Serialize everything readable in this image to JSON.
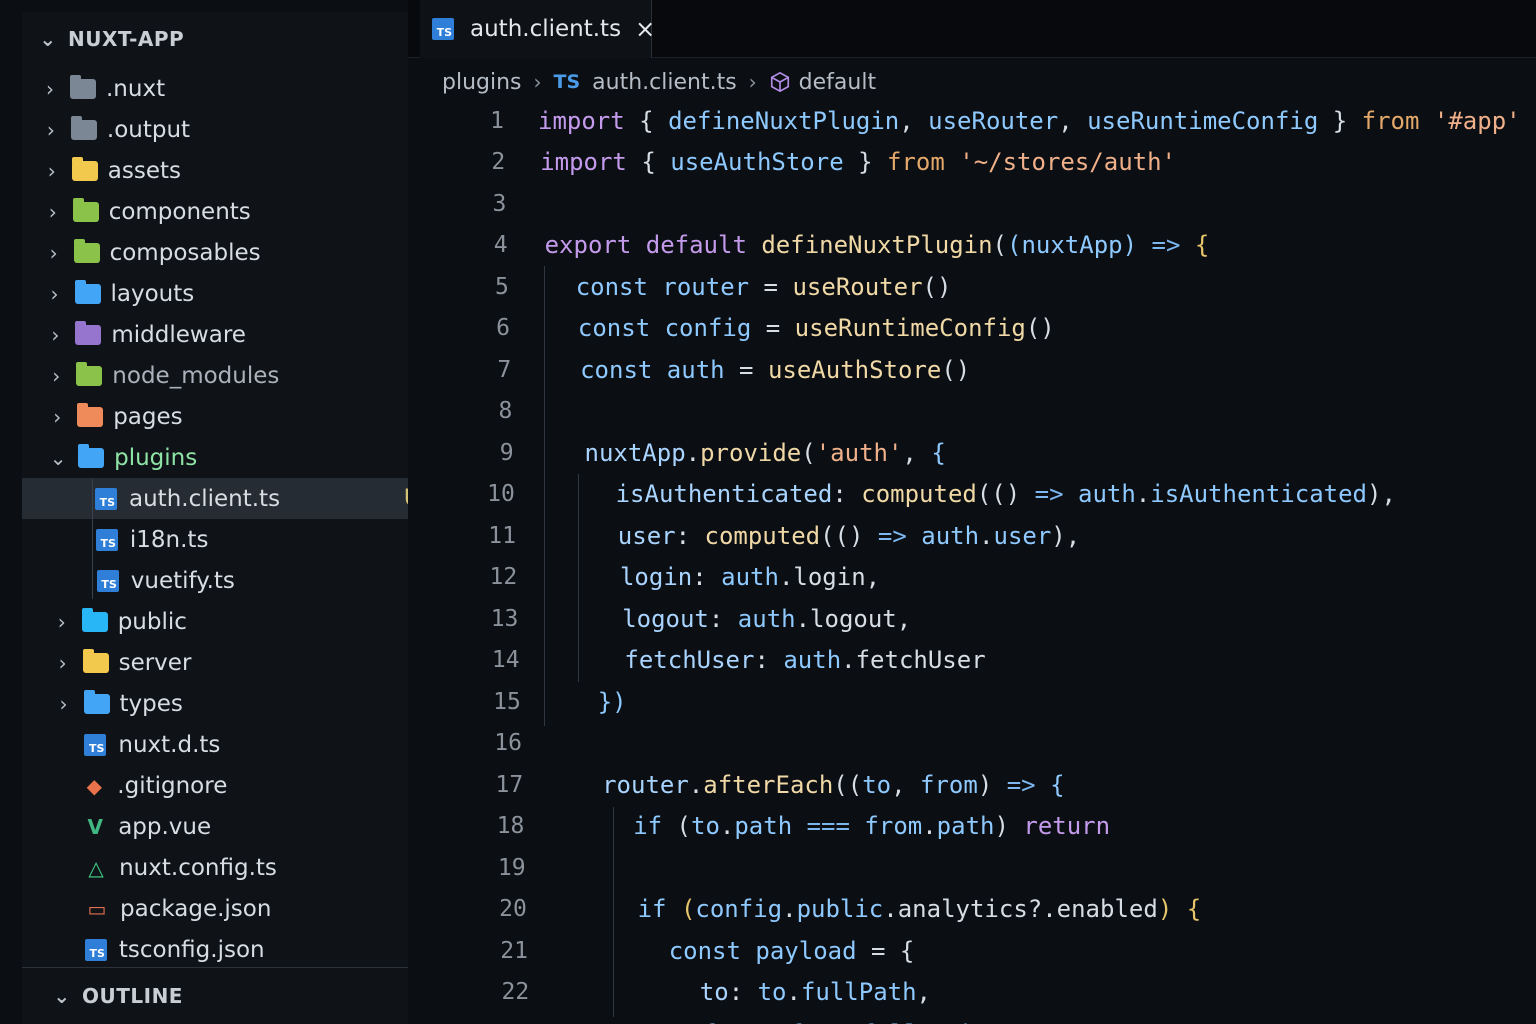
{
  "explorer": {
    "title": "NUXT-APP",
    "items": [
      {
        "label": ".nuxt",
        "type": "folder",
        "color": "#7b8794",
        "expanded": false
      },
      {
        "label": ".output",
        "type": "folder",
        "color": "#7b8794",
        "expanded": false
      },
      {
        "label": "assets",
        "type": "folder",
        "color": "#f2c94c",
        "expanded": false
      },
      {
        "label": "components",
        "type": "folder",
        "color": "#8bc34a",
        "expanded": false
      },
      {
        "label": "composables",
        "type": "folder",
        "color": "#8bc34a",
        "expanded": false
      },
      {
        "label": "layouts",
        "type": "folder",
        "color": "#42a5f5",
        "expanded": false
      },
      {
        "label": "middleware",
        "type": "folder",
        "color": "#9575cd",
        "expanded": false
      },
      {
        "label": "node_modules",
        "type": "folder",
        "color": "#8bc34a",
        "expanded": false
      },
      {
        "label": "pages",
        "type": "folder",
        "color": "#ef8a5b",
        "expanded": false
      },
      {
        "label": "plugins",
        "type": "folder",
        "color": "#42a5f5",
        "expanded": true
      },
      {
        "label": "auth.client.ts",
        "type": "ts",
        "badge": "U",
        "selected": true
      },
      {
        "label": "i18n.ts",
        "type": "ts"
      },
      {
        "label": "vuetify.ts",
        "type": "ts"
      },
      {
        "label": "public",
        "type": "folder",
        "color": "#29b6f6",
        "expanded": false
      },
      {
        "label": "server",
        "type": "folder",
        "color": "#f2c94c",
        "expanded": false
      },
      {
        "label": "types",
        "type": "folder",
        "color": "#42a5f5",
        "expanded": false
      },
      {
        "label": "nuxt.d.ts",
        "type": "ts"
      },
      {
        "label": ".gitignore",
        "type": "git"
      },
      {
        "label": "app.vue",
        "type": "vue"
      },
      {
        "label": "nuxt.config.ts",
        "type": "nuxt"
      },
      {
        "label": "package.json",
        "type": "pkg"
      },
      {
        "label": "tsconfig.json",
        "type": "ts"
      }
    ]
  },
  "outline": {
    "title": "OUTLINE"
  },
  "tab": {
    "icon_text": "TS",
    "label": "auth.client.ts",
    "close": "×"
  },
  "breadcrumb": {
    "folder": "plugins",
    "ts_label": "TS",
    "file": "auth.client.ts",
    "symbol": "default"
  },
  "colors": {
    "accent": "#2f7ed8",
    "git_untracked": "#d6c478"
  },
  "code": {
    "line_numbers": [
      "1",
      "2",
      "3",
      "4",
      "5",
      "6",
      "7",
      "8",
      "9",
      "10",
      "11",
      "12",
      "13",
      "14",
      "15",
      "16",
      "17",
      "18",
      "19",
      "20",
      "21",
      "22"
    ],
    "lines": [
      [
        [
          "k",
          "import"
        ],
        [
          "pun",
          " { "
        ],
        [
          "var",
          "defineNuxtPlugin"
        ],
        [
          "pun",
          ", "
        ],
        [
          "var",
          "useRouter"
        ],
        [
          "pun",
          ", "
        ],
        [
          "var",
          "useRuntimeConfig"
        ],
        [
          "pun",
          " } "
        ],
        [
          "kw2",
          "from"
        ],
        [
          "pun",
          " "
        ],
        [
          "str",
          "'#app'"
        ]
      ],
      [
        [
          "k",
          "import"
        ],
        [
          "pun",
          " { "
        ],
        [
          "var",
          "useAuthStore"
        ],
        [
          "pun",
          " } "
        ],
        [
          "kw2",
          "from"
        ],
        [
          "pun",
          " "
        ],
        [
          "str",
          "'~/stores/auth'"
        ]
      ],
      [],
      [
        [
          "k",
          "export"
        ],
        [
          "pun",
          " "
        ],
        [
          "k",
          "default"
        ],
        [
          "pun",
          " "
        ],
        [
          "fn",
          "defineNuxtPlugin"
        ],
        [
          "pun",
          "("
        ],
        [
          "var",
          "(nuxtApp)"
        ],
        [
          "pun",
          " "
        ],
        [
          "op",
          "=>"
        ],
        [
          "pun",
          " "
        ],
        [
          "brace",
          "{"
        ]
      ],
      [
        [
          "pun",
          "  "
        ],
        [
          "var",
          "const"
        ],
        [
          "pun",
          " "
        ],
        [
          "var",
          "router"
        ],
        [
          "pun",
          " = "
        ],
        [
          "fn",
          "useRouter"
        ],
        [
          "pun",
          "()"
        ]
      ],
      [
        [
          "pun",
          "  "
        ],
        [
          "var",
          "const"
        ],
        [
          "pun",
          " "
        ],
        [
          "var",
          "config"
        ],
        [
          "pun",
          " = "
        ],
        [
          "fn",
          "useRuntimeConfig"
        ],
        [
          "pun",
          "()"
        ]
      ],
      [
        [
          "pun",
          "  "
        ],
        [
          "var",
          "const"
        ],
        [
          "pun",
          " "
        ],
        [
          "var",
          "auth"
        ],
        [
          "pun",
          " = "
        ],
        [
          "fn",
          "useAuthStore"
        ],
        [
          "pun",
          "()"
        ]
      ],
      [],
      [
        [
          "pun",
          "  "
        ],
        [
          "prop",
          "nuxtApp"
        ],
        [
          "pun",
          "."
        ],
        [
          "fn",
          "provide"
        ],
        [
          "pun",
          "("
        ],
        [
          "str",
          "'auth'"
        ],
        [
          "pun",
          ", "
        ],
        [
          "var",
          "{"
        ]
      ],
      [
        [
          "pun",
          "    "
        ],
        [
          "prop",
          "isAuthenticated"
        ],
        [
          "pun",
          ": "
        ],
        [
          "fn",
          "computed"
        ],
        [
          "pun",
          "(() "
        ],
        [
          "op",
          "=>"
        ],
        [
          "pun",
          " "
        ],
        [
          "var",
          "auth"
        ],
        [
          "pun",
          "."
        ],
        [
          "var",
          "isAuthenticated"
        ],
        [
          "pun",
          "),"
        ]
      ],
      [
        [
          "pun",
          "    "
        ],
        [
          "prop",
          "user"
        ],
        [
          "pun",
          ": "
        ],
        [
          "fn",
          "computed"
        ],
        [
          "pun",
          "(() "
        ],
        [
          "op",
          "=>"
        ],
        [
          "pun",
          " "
        ],
        [
          "var",
          "auth"
        ],
        [
          "pun",
          "."
        ],
        [
          "var",
          "user"
        ],
        [
          "pun",
          "),"
        ]
      ],
      [
        [
          "pun",
          "    "
        ],
        [
          "prop",
          "login"
        ],
        [
          "pun",
          ": "
        ],
        [
          "var",
          "auth"
        ],
        [
          "pun",
          "."
        ],
        [
          "pun",
          "login,"
        ]
      ],
      [
        [
          "pun",
          "    "
        ],
        [
          "prop",
          "logout"
        ],
        [
          "pun",
          ": "
        ],
        [
          "var",
          "auth"
        ],
        [
          "pun",
          "."
        ],
        [
          "pun",
          "logout,"
        ]
      ],
      [
        [
          "pun",
          "    "
        ],
        [
          "prop",
          "fetchUser"
        ],
        [
          "pun",
          ": "
        ],
        [
          "var",
          "auth"
        ],
        [
          "pun",
          "."
        ],
        [
          "pun",
          "fetchUser"
        ]
      ],
      [
        [
          "pun",
          "  "
        ],
        [
          "var",
          "})"
        ]
      ],
      [],
      [
        [
          "pun",
          "  "
        ],
        [
          "prop",
          "router"
        ],
        [
          "pun",
          "."
        ],
        [
          "fn",
          "afterEach"
        ],
        [
          "pun",
          "(("
        ],
        [
          "var",
          "to"
        ],
        [
          "pun",
          ", "
        ],
        [
          "var",
          "from"
        ],
        [
          "pun",
          ") "
        ],
        [
          "op",
          "=>"
        ],
        [
          "pun",
          " "
        ],
        [
          "var",
          "{"
        ]
      ],
      [
        [
          "pun",
          "    "
        ],
        [
          "var",
          "if"
        ],
        [
          "pun",
          " ("
        ],
        [
          "var",
          "to"
        ],
        [
          "pun",
          "."
        ],
        [
          "var",
          "path"
        ],
        [
          "pun",
          " "
        ],
        [
          "op",
          "==="
        ],
        [
          "pun",
          " "
        ],
        [
          "var",
          "from"
        ],
        [
          "pun",
          "."
        ],
        [
          "var",
          "path"
        ],
        [
          "pun",
          ") "
        ],
        [
          "k",
          "return"
        ]
      ],
      [],
      [
        [
          "pun",
          "    "
        ],
        [
          "var",
          "if"
        ],
        [
          "pun",
          " "
        ],
        [
          "brace",
          "("
        ],
        [
          "var",
          "config"
        ],
        [
          "pun",
          "."
        ],
        [
          "var",
          "public"
        ],
        [
          "pun",
          "."
        ],
        [
          "pun",
          "analytics?.enabled"
        ],
        [
          "brace",
          ")"
        ],
        [
          "pun",
          " "
        ],
        [
          "brace",
          "{"
        ]
      ],
      [
        [
          "pun",
          "      "
        ],
        [
          "var",
          "const"
        ],
        [
          "pun",
          " "
        ],
        [
          "var",
          "payload"
        ],
        [
          "pun",
          " = {"
        ]
      ],
      [
        [
          "pun",
          "        "
        ],
        [
          "prop",
          "to"
        ],
        [
          "pun",
          ": "
        ],
        [
          "var",
          "to"
        ],
        [
          "pun",
          "."
        ],
        [
          "var",
          "fullPath"
        ],
        [
          "pun",
          ","
        ]
      ],
      [
        [
          "pun",
          "        "
        ],
        [
          "prop",
          "from"
        ],
        [
          "pun",
          ": "
        ],
        [
          "var",
          "from"
        ],
        [
          "pun",
          "."
        ],
        [
          "var",
          "fullPath"
        ],
        [
          "pun",
          ","
        ]
      ]
    ]
  }
}
